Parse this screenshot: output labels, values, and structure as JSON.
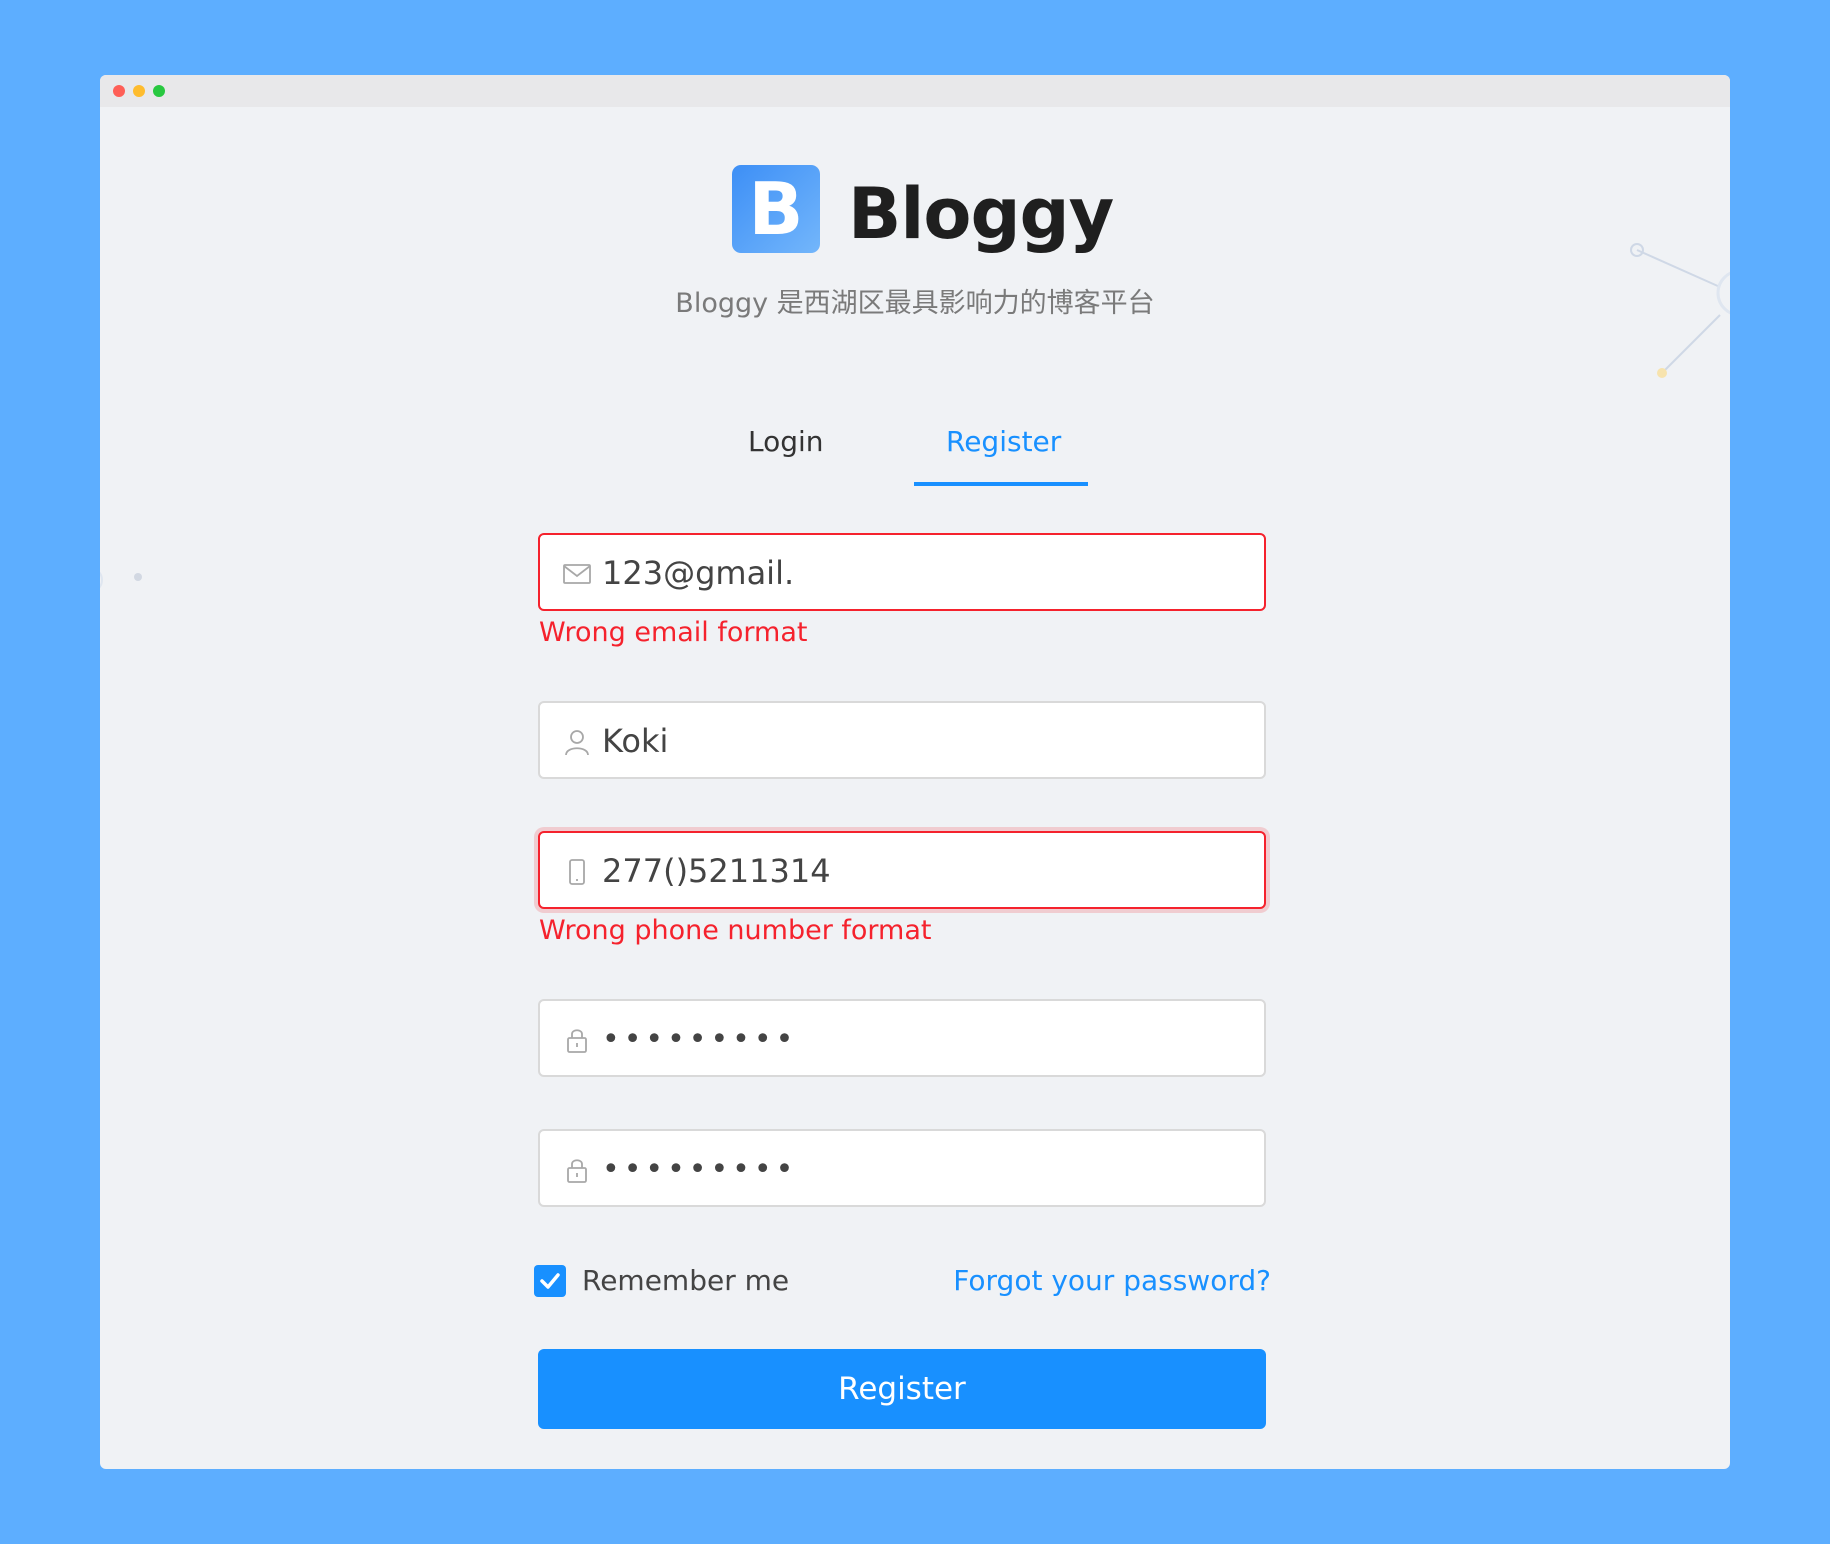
{
  "window": {
    "controls": [
      "close",
      "minimize",
      "zoom"
    ]
  },
  "brand": {
    "logo_letter": "B",
    "title": "Bloggy",
    "subtitle": "Bloggy 是西湖区最具影响力的博客平台"
  },
  "tabs": [
    {
      "label": "Login",
      "active": false
    },
    {
      "label": "Register",
      "active": true
    }
  ],
  "form": {
    "email": {
      "value": "123@gmail.",
      "error": "Wrong email format",
      "icon": "mail-icon"
    },
    "username": {
      "value": "Koki",
      "icon": "user-icon"
    },
    "phone": {
      "value": "277()5211314",
      "error": "Wrong phone number format",
      "icon": "mobile-icon"
    },
    "password": {
      "value": "•••••••••",
      "icon": "lock-icon"
    },
    "confirm_password": {
      "value": "•••••••••",
      "icon": "lock-icon"
    },
    "remember_label": "Remember me",
    "remember_checked": true,
    "forgot_label": "Forgot your password?",
    "submit_label": "Register"
  },
  "colors": {
    "accent": "#1890ff",
    "error": "#f5222d",
    "page_background": "#5daeff",
    "window_background": "#f0f2f5"
  }
}
